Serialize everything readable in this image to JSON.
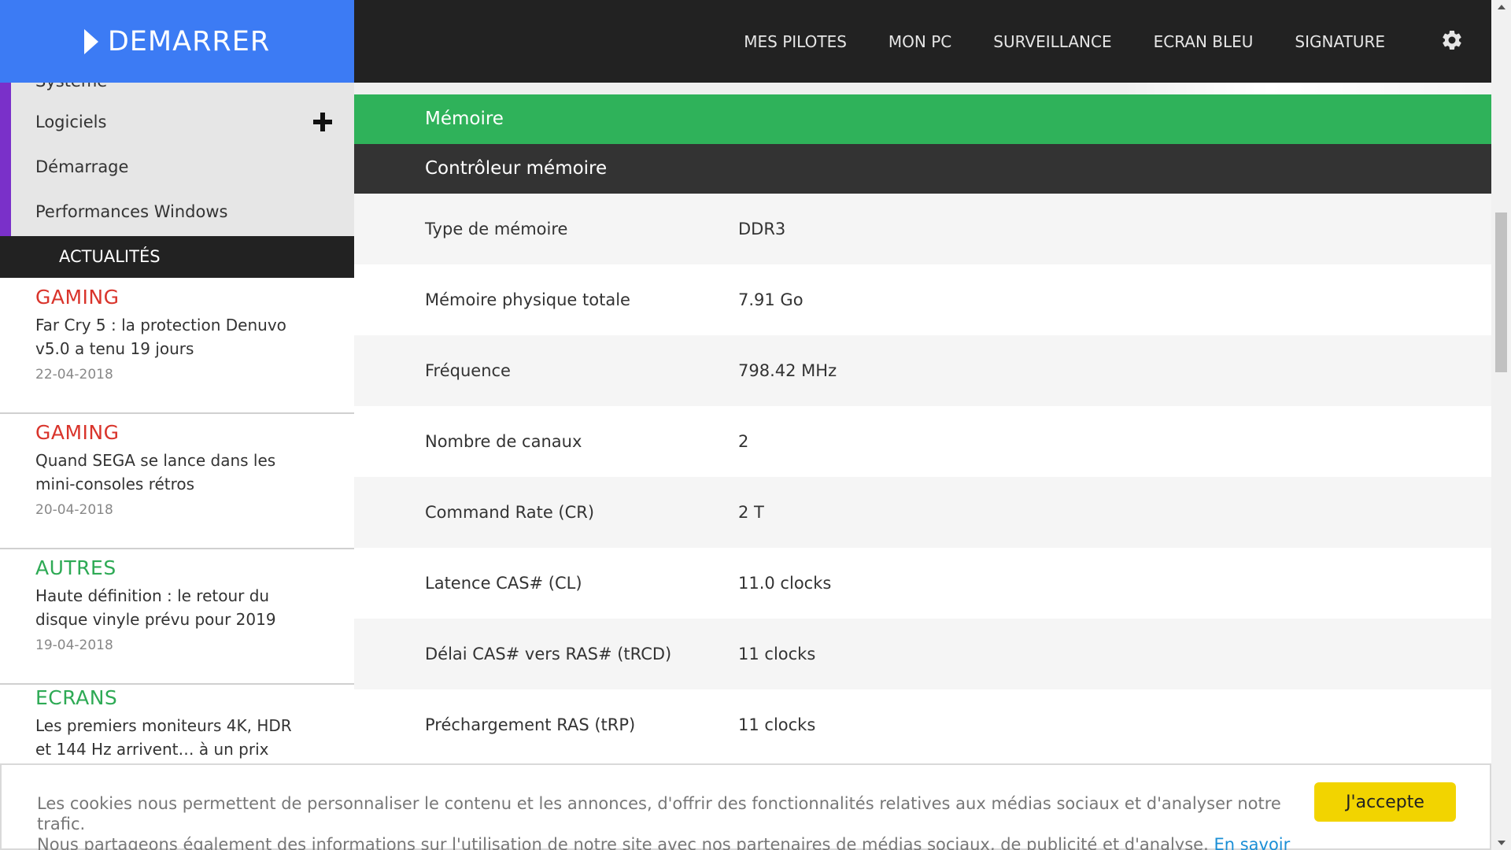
{
  "brand": {
    "label": "DEMARRER"
  },
  "sidebar": {
    "items": [
      {
        "label": "Système"
      },
      {
        "label": "Logiciels"
      },
      {
        "label": "Démarrage"
      },
      {
        "label": "Performances Windows"
      }
    ]
  },
  "news": {
    "heading": "ACTUALITÉS",
    "items": [
      {
        "category": "GAMING",
        "title": "Far Cry 5 : la protection Denuvo v5.0 a tenu 19 jours",
        "date": "22-04-2018"
      },
      {
        "category": "GAMING",
        "title": "Quand SEGA se lance dans les mini-consoles rétros",
        "date": "20-04-2018"
      },
      {
        "category": "AUTRES",
        "title": "Haute définition : le retour du disque vinyle prévu pour 2019",
        "date": "19-04-2018"
      },
      {
        "category": "ECRANS",
        "title": "Les premiers moniteurs 4K, HDR et 144 Hz arrivent… à un prix",
        "date": ""
      }
    ],
    "category_colors": {
      "GAMING": "#d9342b",
      "AUTRES": "#2eaa55",
      "ECRANS": "#2eaa55"
    }
  },
  "topnav": {
    "items": [
      "MES PILOTES",
      "MON PC",
      "SURVEILLANCE",
      "ECRAN BLEU",
      "SIGNATURE"
    ],
    "settings_icon": "gear-icon"
  },
  "main": {
    "section_title": "Mémoire",
    "subsection_title": "Contrôleur mémoire",
    "rows": [
      {
        "label": "Type de mémoire",
        "value": "DDR3"
      },
      {
        "label": "Mémoire physique totale",
        "value": "7.91 Go"
      },
      {
        "label": "Fréquence",
        "value": "798.42 MHz"
      },
      {
        "label": "Nombre de canaux",
        "value": "2"
      },
      {
        "label": "Command Rate (CR)",
        "value": "2 T"
      },
      {
        "label": "Latence CAS# (CL)",
        "value": "11.0 clocks"
      },
      {
        "label": "Délai CAS# vers RAS# (tRCD)",
        "value": "11 clocks"
      },
      {
        "label": "Préchargement RAS (tRP)",
        "value": "11 clocks"
      }
    ]
  },
  "cookie": {
    "text_line1": "Les cookies nous permettent de personnaliser le contenu et les annonces, d'offrir des fonctionnalités relatives aux médias sociaux et d'analyser notre trafic.",
    "text_line2": "Nous partageons également des informations sur l'utilisation de notre site avec nos partenaires de médias sociaux, de publicité et d'analyse.",
    "link": "En savoir plus",
    "accept": "J'accepte"
  },
  "colors": {
    "brand_blue": "#3c7bf4",
    "sidebar_accent": "#7a30c9",
    "section_green": "#2fb25a",
    "dark_header": "#333333",
    "accept_yellow": "#f2d400",
    "link_blue": "#1b8fd6"
  }
}
